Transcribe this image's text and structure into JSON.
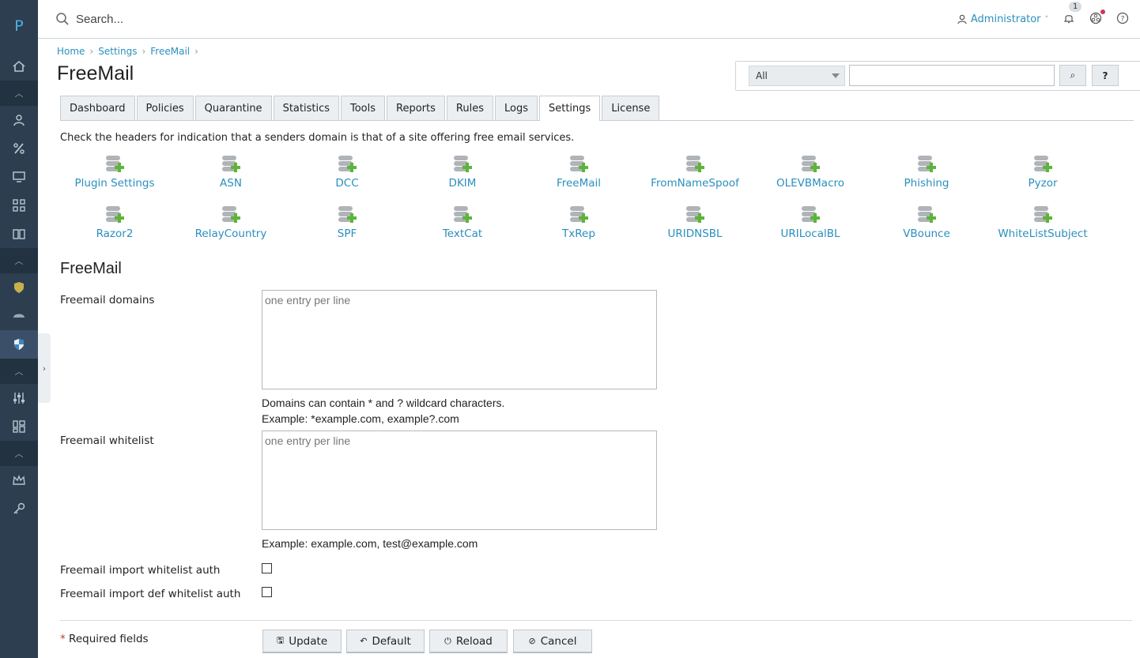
{
  "sidebar": {
    "logo": "P"
  },
  "topbar": {
    "search_placeholder": "Search...",
    "user": "Administrator",
    "notification_count": "1"
  },
  "breadcrumb": [
    "Home",
    "Settings",
    "FreeMail"
  ],
  "page_title": "FreeMail",
  "filter": {
    "select_value": "All",
    "search_button": "⌕",
    "help_button": "?"
  },
  "tabs": [
    "Dashboard",
    "Policies",
    "Quarantine",
    "Statistics",
    "Tools",
    "Reports",
    "Rules",
    "Logs",
    "Settings",
    "License"
  ],
  "active_tab": "Settings",
  "description": "Check the headers for indication that a senders domain is that of a site offering free email services.",
  "plugins_row1": [
    "Plugin Settings",
    "ASN",
    "DCC",
    "DKIM",
    "FreeMail",
    "FromNameSpoof",
    "OLEVBMacro",
    "Phishing",
    "Pyzor"
  ],
  "plugins_row2": [
    "Razor2",
    "RelayCountry",
    "SPF",
    "TextCat",
    "TxRep",
    "URIDNSBL",
    "URILocalBL",
    "VBounce",
    "WhiteListSubject"
  ],
  "section_title": "FreeMail",
  "fields": {
    "domains_label": "Freemail domains",
    "domains_placeholder": "one entry per line",
    "domains_help1": "Domains can contain * and ? wildcard characters.",
    "domains_help2": "Example: *example.com, example?.com",
    "whitelist_label": "Freemail whitelist",
    "whitelist_placeholder": "one entry per line",
    "whitelist_help": "Example: example.com, test@example.com",
    "import_auth_label": "Freemail import whitelist auth",
    "import_def_auth_label": "Freemail import def whitelist auth"
  },
  "footer": {
    "required_star": "*",
    "required_text": " Required fields",
    "update": "Update",
    "default": "Default",
    "reload": "Reload",
    "cancel": "Cancel"
  }
}
